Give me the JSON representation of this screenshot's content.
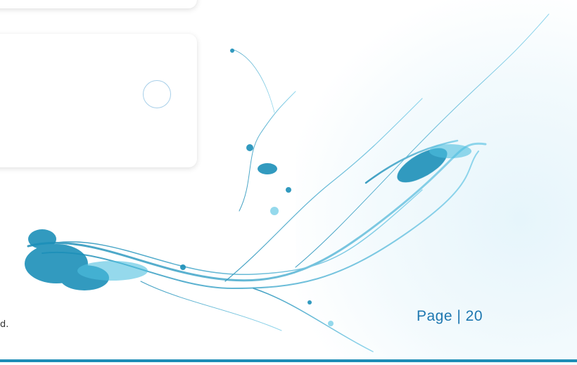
{
  "footer": {
    "copyright_fragment": "d.",
    "page_label": "Page | 20"
  },
  "colors": {
    "accent": "#1d77b0",
    "rule": "#1d8db6",
    "splash": "#2ba3c9"
  },
  "icons": {
    "radio": "radio-option-icon"
  }
}
